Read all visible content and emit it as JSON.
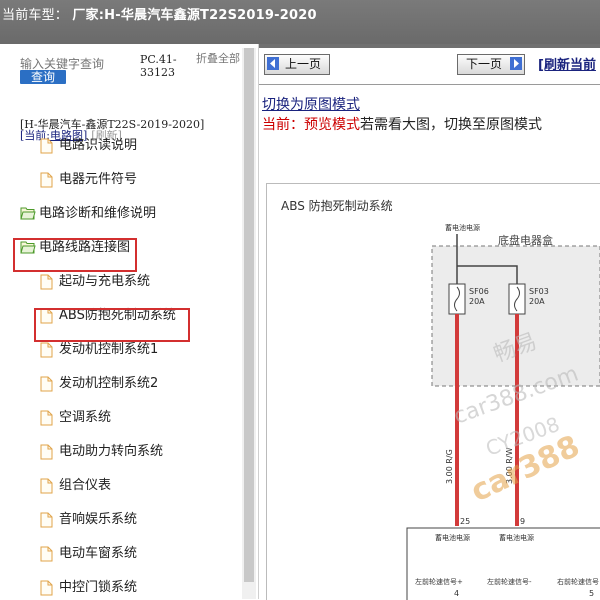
{
  "titlebar": {
    "label": "当前车型：",
    "model": "厂家:H-华晨汽车鑫源T22S2019-2020"
  },
  "sidebar": {
    "search_placeholder": "输入关键字查询",
    "search_button": "查询",
    "code": "PC.41-33123",
    "collapse_all": "折叠全部",
    "vehicle": "[H-华晨汽车-鑫源T22S-2019-2020]",
    "current_label": "[当前:",
    "current_value": "电路图",
    "current_close": "]",
    "refresh": "[刷新]",
    "items": [
      {
        "label": "电路识读说明",
        "type": "file"
      },
      {
        "label": "电器元件符号",
        "type": "file"
      },
      {
        "label": "电路诊断和维修说明",
        "type": "folder"
      },
      {
        "label": "电路线路连接图",
        "type": "folder"
      },
      {
        "label": "起动与充电系统",
        "type": "file"
      },
      {
        "label": "ABS防抱死制动系统",
        "type": "file"
      },
      {
        "label": "发动机控制系统1",
        "type": "file"
      },
      {
        "label": "发动机控制系统2",
        "type": "file"
      },
      {
        "label": "空调系统",
        "type": "file"
      },
      {
        "label": "电动助力转向系统",
        "type": "file"
      },
      {
        "label": "组合仪表",
        "type": "file"
      },
      {
        "label": "音响娱乐系统",
        "type": "file"
      },
      {
        "label": "电动车窗系统",
        "type": "file"
      },
      {
        "label": "中控门锁系统",
        "type": "file"
      }
    ]
  },
  "viewer": {
    "prev": "上一页",
    "next": "下一页",
    "refresh": "[刷新当前",
    "switch_link": "切换为原图模式",
    "mode_current_label": "当前：预览模式",
    "mode_hint": "若需看大图，切换至原图模式"
  },
  "diagram": {
    "title": "ABS 防抱死制动系统",
    "box_label": "底盘电器盒",
    "wire_label_left": "蓄电池电源",
    "wire_label_right": "蓄电池电源",
    "fuse1_name": "SF06",
    "fuse1_rating": "20A",
    "fuse2_name": "SF03",
    "fuse2_rating": "20A",
    "wire1_spec": "3.00 R/G",
    "wire2_spec": "3.00 R/W",
    "pin1": "25",
    "pin2": "9",
    "module_label1": "蓄电池电源",
    "module_label2": "蓄电池电源",
    "bottom_label1": "左前轮速信号+",
    "bottom_label2": "左前轮速信号-",
    "bottom_label3": "右前轮速信号",
    "pin3": "4",
    "pin4": "5",
    "watermark1": "畅易",
    "watermark2": "car388.com",
    "watermark3": "CY2008",
    "watermark4": "car388",
    "wire_color_red": "#d23a3a",
    "wire_color_pink": "#e8a0a0"
  }
}
